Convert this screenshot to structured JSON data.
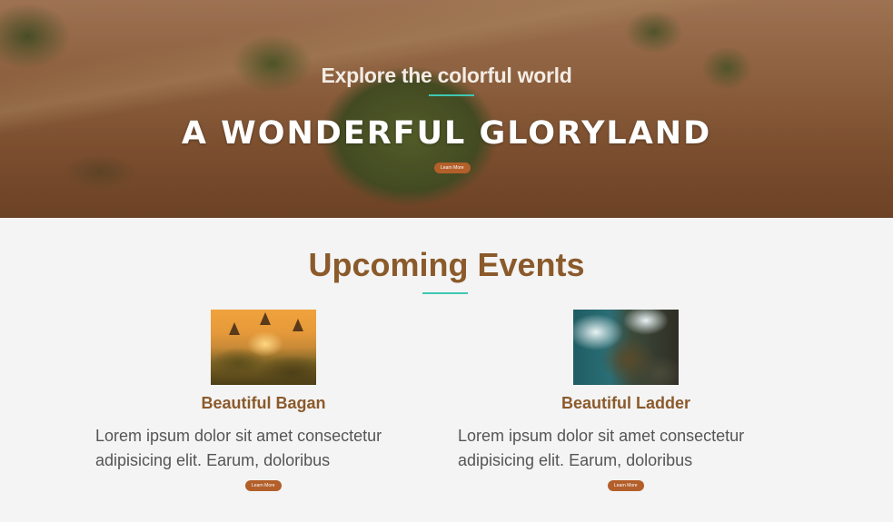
{
  "hero": {
    "subtitle": "Explore the colorful world",
    "title": "A WONDERFUL GLORYLAND",
    "button_label": "Learn More"
  },
  "events_section": {
    "title": "Upcoming Events",
    "events": [
      {
        "name": "Beautiful Bagan",
        "description": "Lorem ipsum dolor sit amet consectetur adipisicing elit. Earum, doloribus",
        "button_label": "Learn More"
      },
      {
        "name": "Beautiful Ladder",
        "description": "Lorem ipsum dolor sit amet consectetur adipisicing elit. Earum, doloribus",
        "button_label": "Learn More"
      }
    ]
  },
  "colors": {
    "accent_brown": "#8b5a2b",
    "button_orange": "#b35f2a",
    "divider_teal": "#3fc7b3"
  }
}
